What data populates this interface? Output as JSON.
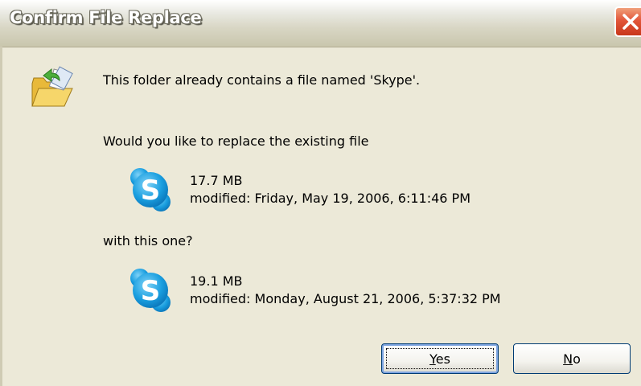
{
  "dialog": {
    "title": "Confirm File Replace",
    "message": "This folder already contains a file named 'Skype'.",
    "question": "Would you like to replace the existing file",
    "with_text": "with this one?",
    "existing_file": {
      "size": "17.7 MB",
      "modified": "modified: Friday, May 19, 2006, 6:11:46 PM",
      "icon": "skype-icon"
    },
    "new_file": {
      "size": "19.1 MB",
      "modified": "modified: Monday, August 21, 2006, 5:37:32 PM",
      "icon": "skype-icon"
    },
    "buttons": {
      "yes_prefix": "Y",
      "yes_rest": "es",
      "no_prefix": "N",
      "no_rest": "o"
    }
  },
  "colors": {
    "dialog_bg": "#ece9d8",
    "close_red": "#e2563a",
    "skype_blue": "#1a9fe0"
  }
}
